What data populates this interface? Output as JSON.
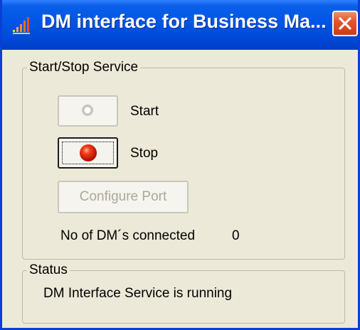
{
  "window": {
    "title": "DM interface for Business Ma...",
    "icon": "app-icon",
    "close_icon": "close-icon"
  },
  "service_group": {
    "legend": "Start/Stop Service",
    "start": {
      "label": "Start",
      "enabled": false,
      "icon": "gray-dot-icon"
    },
    "stop": {
      "label": "Stop",
      "enabled": true,
      "focused": true,
      "icon": "red-dot-icon"
    },
    "configure_port": {
      "label": "Configure Port",
      "enabled": false
    },
    "dm_connected": {
      "label": "No of DM´s connected",
      "value": "0"
    }
  },
  "status_group": {
    "legend": "Status",
    "text": "DM Interface Service is running"
  },
  "colors": {
    "titlebar": "#0055e5",
    "window_bg": "#ece9d8",
    "close_button": "#e5562d",
    "stop_dot": "#e8170b",
    "disabled_text": "#aca899"
  }
}
